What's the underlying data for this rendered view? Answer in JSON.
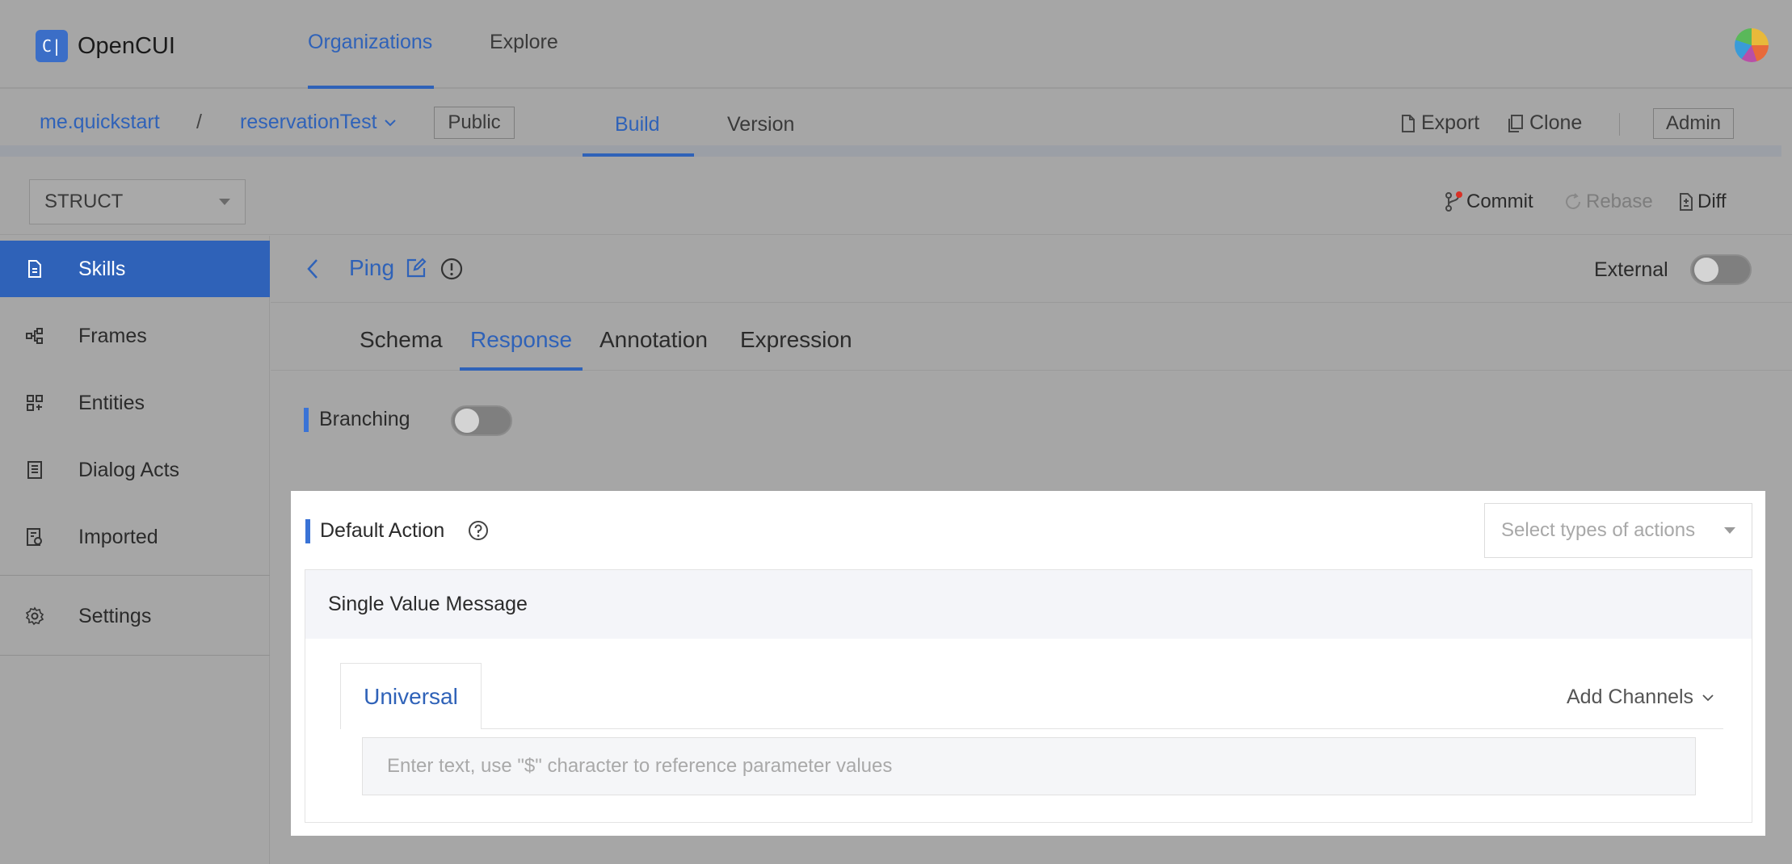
{
  "app": {
    "logo_mark": "C|",
    "name": "OpenCUI"
  },
  "topnav": {
    "items": [
      {
        "label": "Organizations",
        "active": true
      },
      {
        "label": "Explore",
        "active": false
      }
    ]
  },
  "breadcrumb": {
    "org": "me.quickstart",
    "separator": "/",
    "project": "reservationTest",
    "visibility": "Public"
  },
  "project_tabs": [
    {
      "label": "Build",
      "active": true
    },
    {
      "label": "Version",
      "active": false
    }
  ],
  "project_actions": {
    "export": "Export",
    "clone": "Clone",
    "admin": "Admin"
  },
  "toolbar": {
    "mode_select": "STRUCT",
    "commit": "Commit",
    "rebase": "Rebase",
    "diff": "Diff"
  },
  "sidebar": {
    "items": [
      {
        "label": "Skills",
        "icon": "file-icon",
        "active": true
      },
      {
        "label": "Frames",
        "icon": "frames-icon",
        "active": false
      },
      {
        "label": "Entities",
        "icon": "entities-icon",
        "active": false
      },
      {
        "label": "Dialog Acts",
        "icon": "dialog-acts-icon",
        "active": false
      },
      {
        "label": "Imported",
        "icon": "imported-icon",
        "active": false
      },
      {
        "label": "Settings",
        "icon": "gear-icon",
        "active": false
      }
    ]
  },
  "skill": {
    "name": "Ping",
    "external_label": "External",
    "external_on": false
  },
  "skill_tabs": [
    {
      "label": "Schema",
      "active": false
    },
    {
      "label": "Response",
      "active": true
    },
    {
      "label": "Annotation",
      "active": false
    },
    {
      "label": "Expression",
      "active": false
    }
  ],
  "branching": {
    "label": "Branching",
    "on": false
  },
  "default_action": {
    "label": "Default Action",
    "select_placeholder": "Select types of actions",
    "message_type": "Single Value Message",
    "channel_tab": "Universal",
    "add_channels": "Add Channels",
    "input_placeholder": "Enter text, use \"$\" character to reference parameter values"
  },
  "colors": {
    "accent": "#2f62b8",
    "sidebar_active": "#2f62b8",
    "overlay": "#a6a6a6",
    "panel": "#ffffff"
  }
}
